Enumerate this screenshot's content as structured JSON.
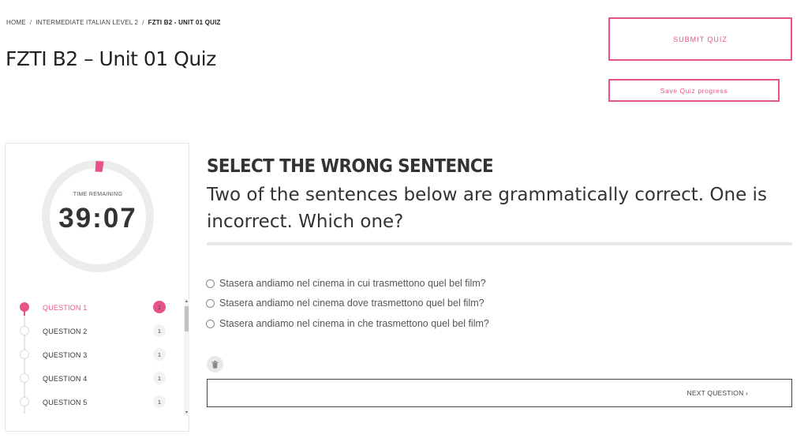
{
  "breadcrumb": {
    "home": "HOME",
    "course": "INTERMEDIATE ITALIAN LEVEL 2",
    "current": "FZTI B2 - UNIT 01 QUIZ",
    "separator": "/"
  },
  "page_title": "FZTI B2 – Unit 01 Quiz",
  "actions": {
    "submit_label": "SUBMIT QUIZ",
    "save_label": "Save Quiz progress"
  },
  "timer": {
    "label": "TIME REMAINING",
    "value": "39:07"
  },
  "questions": [
    {
      "label": "QUESTION 1",
      "count": "1",
      "active": true
    },
    {
      "label": "QUESTION 2",
      "count": "1",
      "active": false
    },
    {
      "label": "QUESTION 3",
      "count": "1",
      "active": false
    },
    {
      "label": "QUESTION 4",
      "count": "1",
      "active": false
    },
    {
      "label": "QUESTION 5",
      "count": "1",
      "active": false
    }
  ],
  "question": {
    "heading": "SELECT THE WRONG SENTENCE",
    "text": "Two of the sentences below are grammatically correct. One is incorrect. Which one?",
    "answers": [
      "Stasera andiamo nel cinema in cui trasmettono quel bel film?",
      "Stasera andiamo nel cinema dove trasmettono quel bel film?",
      "Stasera andiamo nel cinema in che trasmettono quel bel film?"
    ]
  },
  "navigation": {
    "next_label": "NEXT QUESTION ›"
  },
  "icons": {
    "clear": "trash-icon",
    "scroll_up": "scroll-up-icon",
    "scroll_down": "scroll-down-icon"
  },
  "colors": {
    "accent": "#e8528a"
  }
}
